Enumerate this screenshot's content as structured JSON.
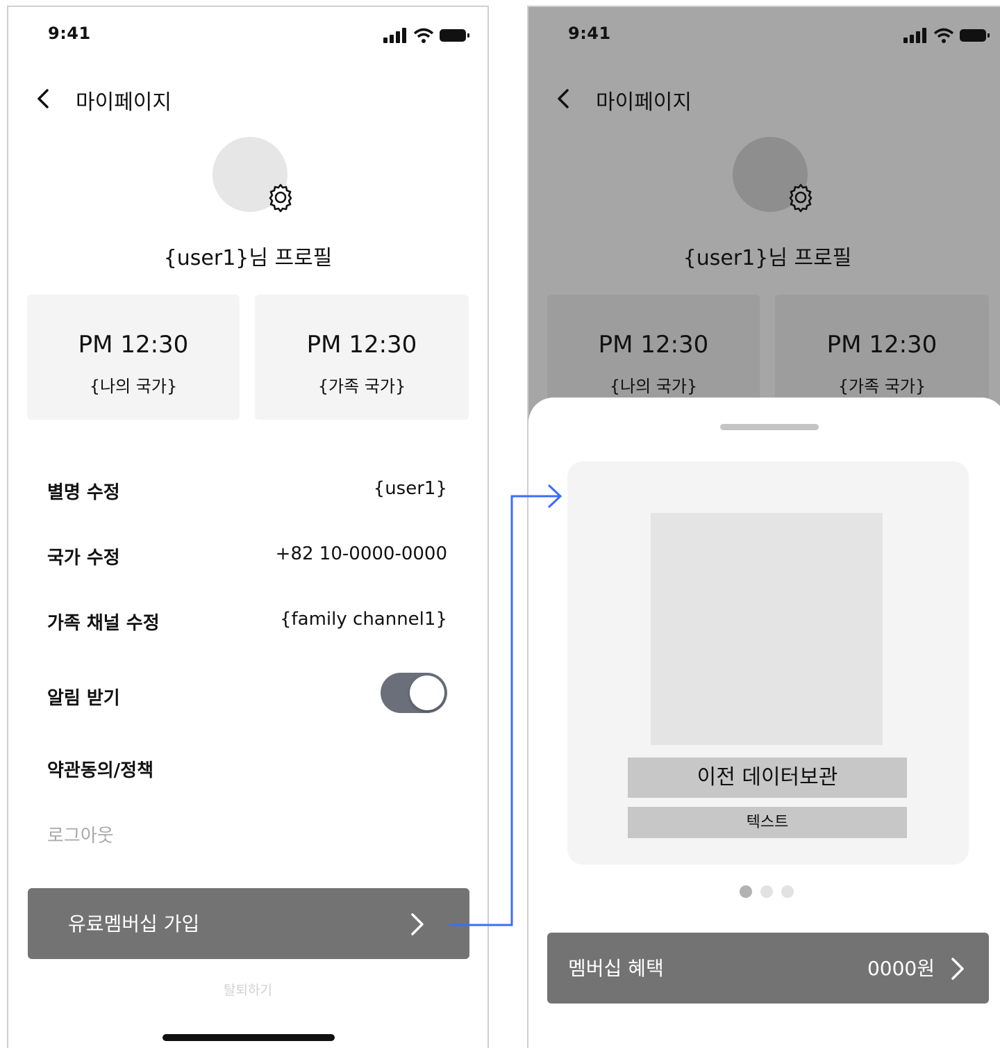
{
  "colors": {
    "dim_background": "#a6a6a6",
    "button_gray": "#737373",
    "card_gray": "#f4f4f4",
    "toggle_on": "#6b6f79",
    "flow_arrow": "#3b6cff"
  },
  "left_screen": {
    "status_time": "9:41",
    "header": {
      "back_icon": "chevron-left-icon",
      "title": "마이페이지"
    },
    "profile": {
      "settings_icon": "gear-icon",
      "name": "{user1}님 프로필"
    },
    "time_cards": [
      {
        "time": "PM 12:30",
        "country": "{나의 국가}"
      },
      {
        "time": "PM 12:30",
        "country": "{가족 국가}"
      }
    ],
    "settings": [
      {
        "label": "별명 수정",
        "value": "{user1}"
      },
      {
        "label": "국가 수정",
        "value": "+82 10-0000-0000"
      },
      {
        "label": "가족 채널 수정",
        "value": "{family channel1}"
      }
    ],
    "notifications": {
      "label": "알림 받기",
      "enabled": true
    },
    "terms_label": "약관동의/정책",
    "logout_label": "로그아웃",
    "membership_button": "유료멤버십 가입",
    "withdraw_label": "탈퇴하기"
  },
  "right_screen": {
    "status_time": "9:41",
    "header": {
      "back_icon": "chevron-left-icon",
      "title": "마이페이지"
    },
    "profile": {
      "settings_icon": "gear-icon",
      "name": "{user1}님 프로필"
    },
    "time_cards": [
      {
        "time": "PM 12:30",
        "country": "{나의 국가}"
      },
      {
        "time": "PM 12:30",
        "country": "{가족 국가}"
      }
    ],
    "sheet": {
      "slide_title": "이전 데이터보관",
      "slide_text": "텍스트",
      "pager": {
        "count": 3,
        "active_index": 0
      },
      "benefit_label": "멤버십 혜택",
      "benefit_price": "0000원"
    }
  }
}
